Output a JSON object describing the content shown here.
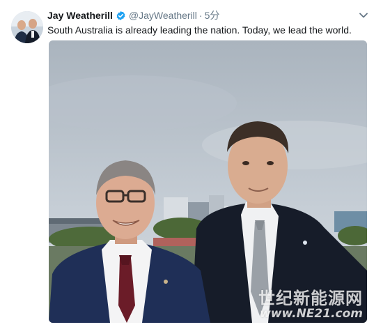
{
  "tweet": {
    "author_name": "Jay Weatherill",
    "handle": "@JayWeatherill",
    "separator": "·",
    "time": "5分",
    "text": "South Australia is already leading the nation. Today, we lead the world.",
    "verified": true
  },
  "icons": {
    "verified": "verified-badge-icon",
    "menu": "chevron-down-icon"
  },
  "colors": {
    "verified_blue": "#1da1f2",
    "text_primary": "#14171a",
    "text_secondary": "#657786"
  },
  "watermark": {
    "chinese": "世纪新能源网",
    "url": "www.NE21.com"
  }
}
